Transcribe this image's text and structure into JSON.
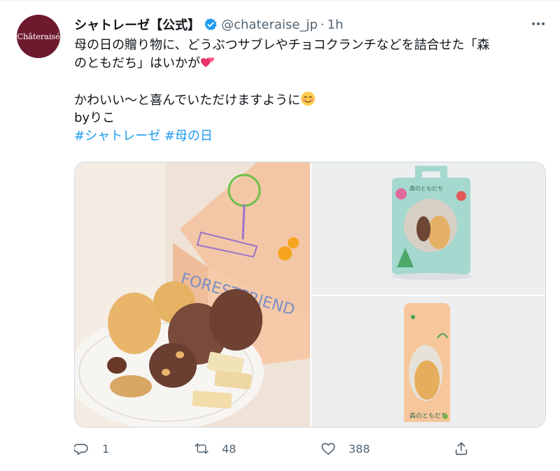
{
  "account": {
    "avatar_text": "Châteraisé",
    "name": "シャトレーゼ【公式】",
    "handle": "@chateraise_jp",
    "separator": "·",
    "time": "1h"
  },
  "tweet": {
    "line1": "母の日の贈り物に、どうぶつサブレやチョコクランチなどを詰合せた「森",
    "line2": "のともだち」はいかが",
    "line3": "かわいい〜と喜んでいただけますように",
    "line4": "byりこ",
    "hashtags": [
      "#シャトレーゼ",
      "#母の日"
    ]
  },
  "media": {
    "box_print": "FORESTFRIEND",
    "package_label": "森のともだち"
  },
  "actions": {
    "reply_count": "1",
    "retweet_count": "48",
    "like_count": "388"
  },
  "colors": {
    "accent": "#1d9bf0",
    "text": "#0f1419",
    "secondary": "#536471",
    "avatar_bg": "#6e1a2e"
  },
  "icons": [
    "verified-badge-icon",
    "more-icon",
    "two-hearts-emoji-icon",
    "smiling-face-emoji-icon",
    "reply-icon",
    "retweet-icon",
    "like-icon",
    "share-icon"
  ]
}
